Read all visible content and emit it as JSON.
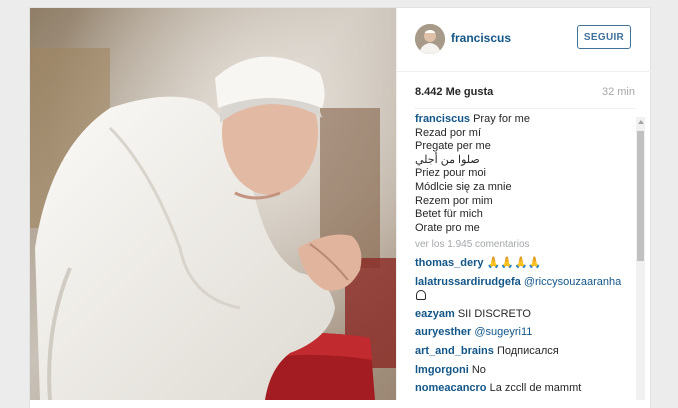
{
  "post": {
    "username": "franciscus",
    "follow_label": "SEGUIR",
    "likes": "8.442 Me gusta",
    "time": "32 min",
    "caption_user": "franciscus",
    "caption_lines": [
      "Pray for me",
      "Rezad por mí",
      "Pregate per me",
      "صلوا من أجلي",
      "Priez pour moi",
      "Módlcie się za mnie",
      "Rezem por mim",
      "Betet für mich",
      "Orate pro me"
    ],
    "view_all_comments": "ver los 1.945 comentarios"
  },
  "comments": [
    {
      "user": "thomas_dery",
      "text": "🙏🙏🙏🙏"
    },
    {
      "user": "lalatrussardirudgefa",
      "mention": "@riccysouzaaranha",
      "text": ""
    },
    {
      "user": "eazyam",
      "text": "SII DISCRETO"
    },
    {
      "user": "auryesther",
      "mention": "@sugeyri11",
      "text": ""
    },
    {
      "user": "art_and_brains",
      "text": "Подписался"
    },
    {
      "user": "lmgorgoni",
      "text": "No"
    },
    {
      "user": "nomeacancro",
      "text": "La zccll de mammt"
    }
  ],
  "icons": {
    "ghost": "ghost-icon",
    "praying": "praying-hands-icon"
  },
  "colors": {
    "link": "#125688",
    "follow_border": "#3f729b",
    "muted": "#a5a7aa"
  }
}
